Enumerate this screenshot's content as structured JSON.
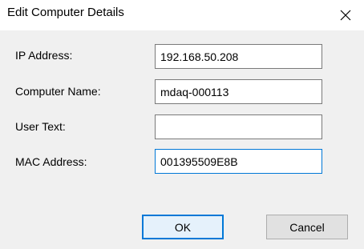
{
  "window": {
    "title": "Edit Computer Details",
    "close_icon": "close-icon"
  },
  "form": {
    "ip_address": {
      "label": "IP Address:",
      "value": "192.168.50.208"
    },
    "computer_name": {
      "label": "Computer Name:",
      "value": "mdaq-000113"
    },
    "user_text": {
      "label": "User Text:",
      "value": ""
    },
    "mac_address": {
      "label": "MAC Address:",
      "value": "001395509E8B"
    }
  },
  "buttons": {
    "ok_label": "OK",
    "cancel_label": "Cancel"
  },
  "colors": {
    "accent": "#0078d7",
    "dialog_background": "#f0f0f0"
  }
}
